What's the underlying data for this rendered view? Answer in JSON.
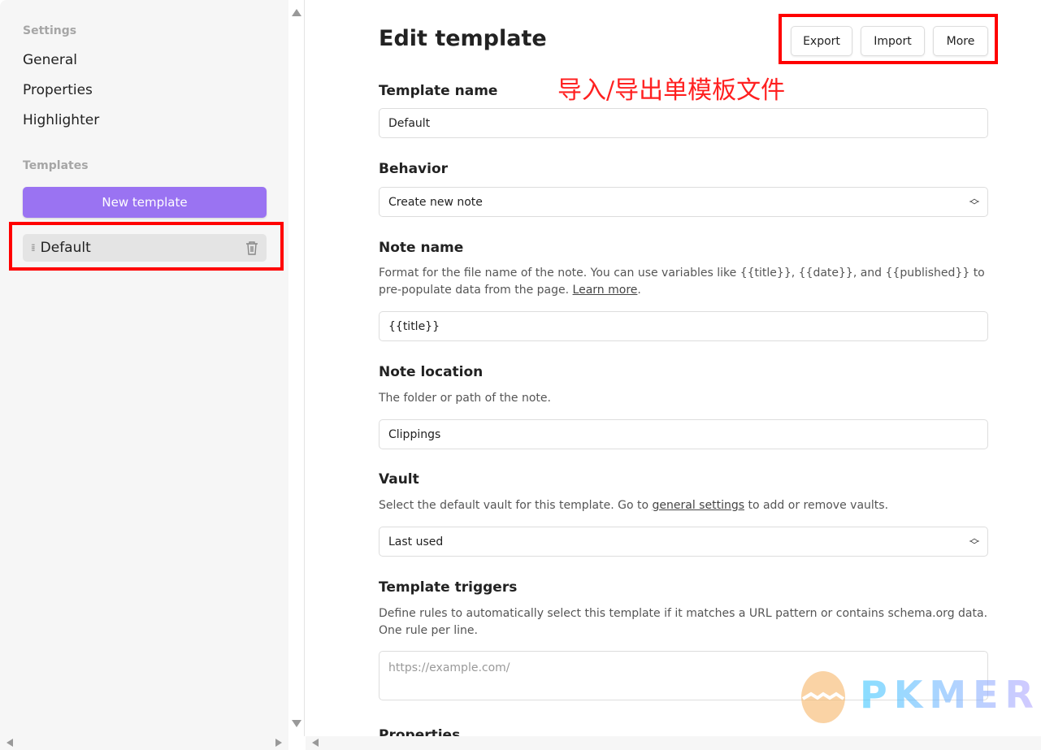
{
  "sidebar": {
    "settings_heading": "Settings",
    "items": [
      {
        "label": "General"
      },
      {
        "label": "Properties"
      },
      {
        "label": "Highlighter"
      }
    ],
    "templates_heading": "Templates",
    "new_template": "New template",
    "templates": [
      {
        "label": "Default"
      }
    ]
  },
  "header": {
    "title": "Edit template",
    "export": "Export",
    "import": "Import",
    "more": "More"
  },
  "annotation": "导入/导出单模板文件",
  "form": {
    "template_name": {
      "label": "Template name",
      "value": "Default"
    },
    "behavior": {
      "label": "Behavior",
      "value": "Create new note"
    },
    "note_name": {
      "label": "Note name",
      "desc": "Format for the file name of the note. You can use variables like {{title}}, {{date}}, and {{published}} to pre-populate data from the page. ",
      "link": "Learn more",
      "value": "{{title}}"
    },
    "note_location": {
      "label": "Note location",
      "desc": "The folder or path of the note.",
      "value": "Clippings"
    },
    "vault": {
      "label": "Vault",
      "desc_before": "Select the default vault for this template. Go to ",
      "link": "general settings",
      "desc_after": " to add or remove vaults.",
      "value": "Last used"
    },
    "triggers": {
      "label": "Template triggers",
      "desc": "Define rules to automatically select this template if it matches a URL pattern or contains schema.org data. One rule per line.",
      "placeholder": "https://example.com/"
    },
    "properties": {
      "label": "Properties"
    }
  },
  "watermark": "PKMER",
  "colors": {
    "accent": "#9a73f2",
    "annotation": "#ff0000"
  }
}
